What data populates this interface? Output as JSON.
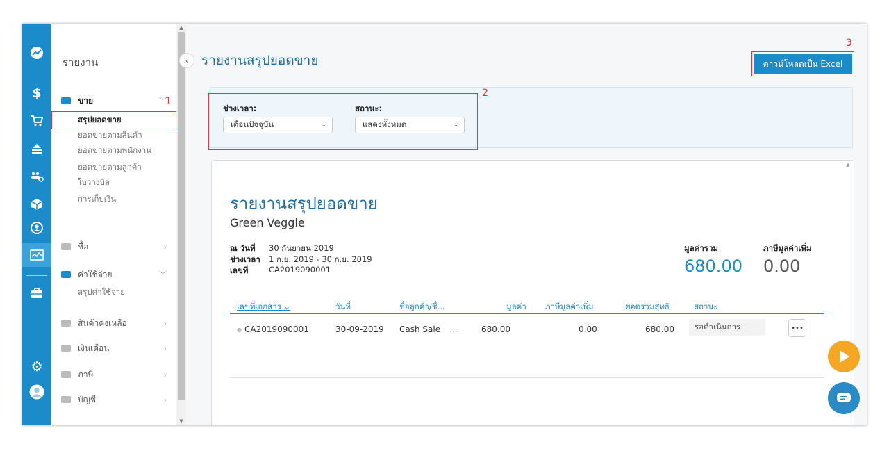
{
  "sidebar": {
    "title": "รายงาน",
    "groups": [
      {
        "label": "ขาย",
        "chev": "﹀"
      },
      {
        "label": "ซื้อ",
        "chev": "›"
      },
      {
        "label": "ค่าใช้จ่าย",
        "chev": "﹀"
      },
      {
        "label": "สินค้าคงเหลือ",
        "chev": "›"
      },
      {
        "label": "เงินเดือน",
        "chev": "›"
      },
      {
        "label": "ภาษี",
        "chev": "›"
      },
      {
        "label": "บัญชี",
        "chev": "›"
      }
    ],
    "sales_items": [
      "สรุปยอดขาย",
      "ยอดขายตามสินค้า",
      "ยอดขายตามพนักงาน",
      "ยอดขายตามลูกค้า",
      "ใบวางบิล",
      "การเก็บเงิน"
    ],
    "expense_items": [
      "สรุปค่าใช้จ่าย"
    ]
  },
  "rail_icons": [
    "dashboard-icon",
    "dollar-icon",
    "cart-icon",
    "upload-icon",
    "contacts-icon",
    "box-icon",
    "user-circle-icon",
    "report-icon",
    "briefcase-icon",
    "gear-icon",
    "avatar-icon"
  ],
  "annotations": {
    "n1": "1",
    "n2": "2",
    "n3": "3"
  },
  "header": {
    "title": "รายงานสรุปยอดขาย",
    "download_label": "ดาวน์โหลดเป็น Excel"
  },
  "filters": {
    "period_label": "ช่วงเวลา:",
    "period_value": "เดือนปัจจุบัน",
    "status_label": "สถานะ:",
    "status_value": "แสดงทั้งหมด"
  },
  "report": {
    "title": "รายงานสรุปยอดขาย",
    "company": "Green Veggie",
    "as_of_label": "ณ วันที่",
    "as_of_value": "30 กันยายน 2019",
    "period_label": "ช่วงเวลา",
    "period_value": "1 ก.ย. 2019 - 30 ก.ย. 2019",
    "number_label": "เลขที่",
    "number_value": "CA2019090001",
    "total_label": "มูลค่ารวม",
    "total_value": "680.00",
    "vat_label": "ภาษีมูลค่าเพิ่ม",
    "vat_value": "0.00",
    "columns": [
      "เลขที่เอกสาร ⌄",
      "วันที่",
      "ชื่อลูกค้า/ชื่...",
      "มูลค่า",
      "ภาษีมูลค่าเพิ่ม",
      "ยอดรวมสุทธิ",
      "สถานะ"
    ],
    "rows": [
      {
        "doc": "CA2019090001",
        "date": "30-09-2019",
        "customer": "Cash Sale",
        "ellipsis": "...",
        "amount": "680.00",
        "vat": "0.00",
        "net": "680.00",
        "status": "รอดำเนินการ",
        "more": "•••"
      }
    ]
  },
  "colors": {
    "primary": "#1b8bc9",
    "title": "#1f6fa8",
    "annotation": "#e33333",
    "fab_play": "#f5a623",
    "fab_chat": "#2b8bc6"
  }
}
